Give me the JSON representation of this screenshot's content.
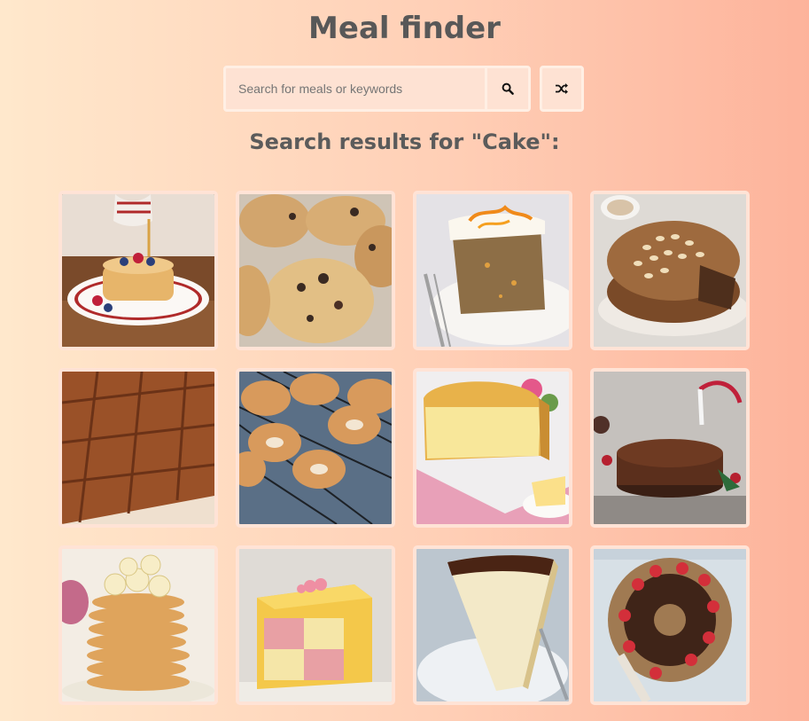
{
  "header": {
    "title": "Meal finder"
  },
  "search": {
    "placeholder": "Search for meals or keywords",
    "value": "",
    "search_button_icon": "search-icon",
    "random_button_icon": "shuffle-icon"
  },
  "results": {
    "heading": "Search results for \"Cake\":",
    "query": "Cake",
    "meals": [
      {
        "name": "pancakes",
        "icon": "pancakes"
      },
      {
        "name": "rock-cakes",
        "icon": "rock-cakes"
      },
      {
        "name": "carrot-cake",
        "icon": "carrot-cake"
      },
      {
        "name": "dundee-cake",
        "icon": "dundee-cake"
      },
      {
        "name": "gingerbread-squares",
        "icon": "gingerbread"
      },
      {
        "name": "doughnuts",
        "icon": "doughnuts"
      },
      {
        "name": "madeira-cake",
        "icon": "madeira-cake"
      },
      {
        "name": "christmas-cake",
        "icon": "christmas-cake"
      },
      {
        "name": "banana-pancakes",
        "icon": "banana-pancakes"
      },
      {
        "name": "battenberg-cake",
        "icon": "battenberg-cake"
      },
      {
        "name": "cheesecake",
        "icon": "cheesecake"
      },
      {
        "name": "chocolate-bundt-cake",
        "icon": "bundt-cake"
      }
    ]
  },
  "colors": {
    "background_start": "#ffe8cc",
    "background_end": "#fdb39b",
    "card_border": "#ffe3d6",
    "title_text": "#585858"
  }
}
